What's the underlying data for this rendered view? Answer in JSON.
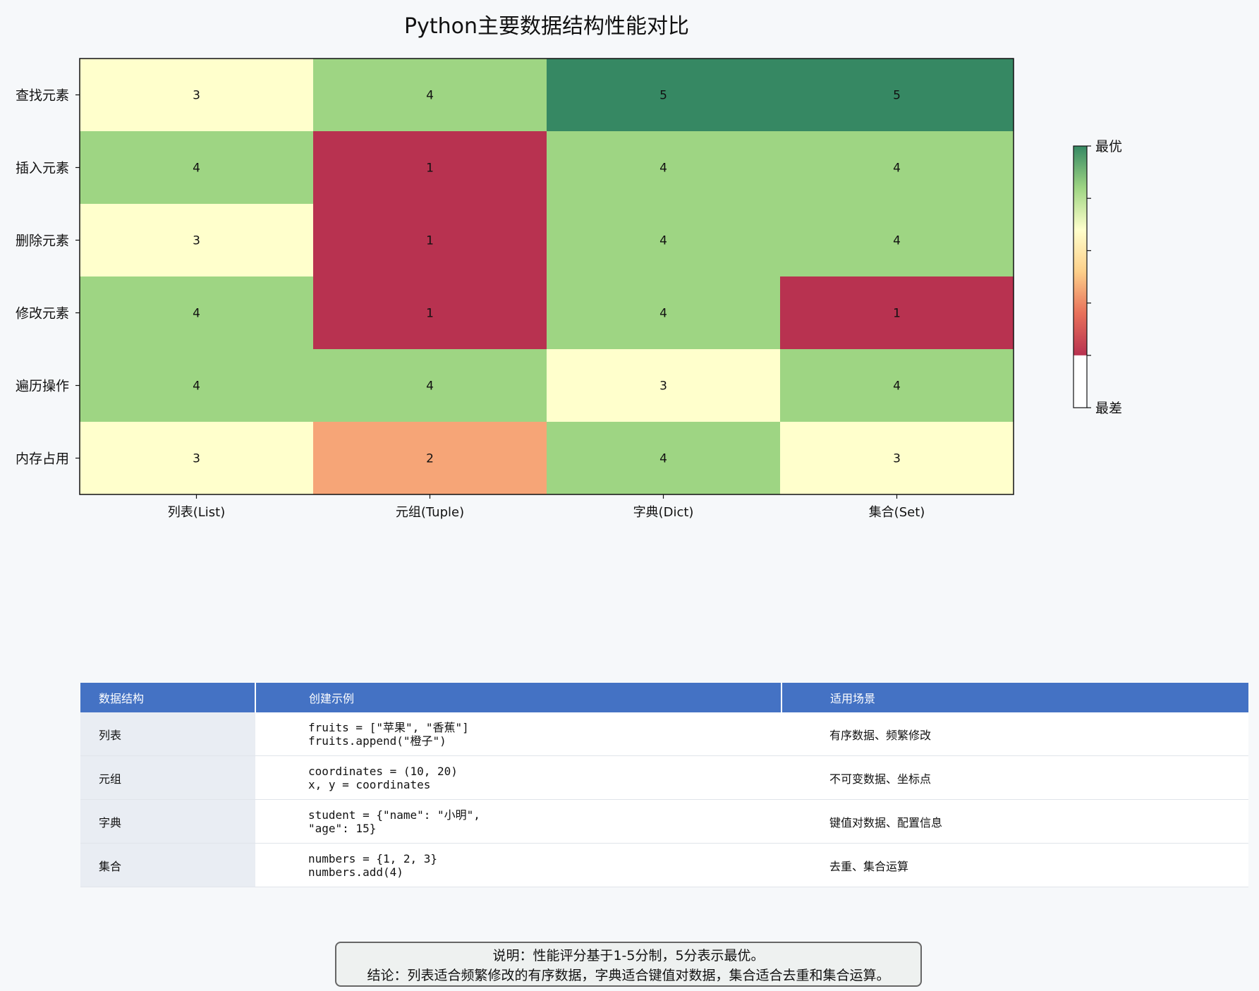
{
  "chart_data": {
    "type": "heatmap",
    "title": "Python主要数据结构性能对比",
    "categories": [
      "列表(List)",
      "元组(Tuple)",
      "字典(Dict)",
      "集合(Set)"
    ],
    "rows": [
      "查找元素",
      "插入元素",
      "删除元素",
      "修改元素",
      "遍历操作",
      "内存占用"
    ],
    "values": [
      [
        3,
        4,
        5,
        5
      ],
      [
        4,
        1,
        4,
        4
      ],
      [
        3,
        1,
        4,
        4
      ],
      [
        4,
        1,
        4,
        1
      ],
      [
        4,
        4,
        3,
        4
      ],
      [
        3,
        2,
        4,
        3
      ]
    ],
    "value_range": [
      1,
      5
    ],
    "colors": {
      "1": "#b83250",
      "2": "#f6a577",
      "3": "#ffffcc",
      "4": "#9ed583",
      "5": "#368863"
    },
    "colorbar": {
      "top_label": "最优",
      "bottom_label": "最差",
      "gradient": [
        "#368863",
        "#9ed583",
        "#ffffcc",
        "#fdd08a",
        "#e8705a",
        "#b83250"
      ]
    },
    "grid": false
  },
  "table": {
    "headers": [
      "数据结构",
      "创建示例",
      "适用场景"
    ],
    "rows": [
      {
        "name": "列表",
        "code": [
          "fruits = [\"苹果\", \"香蕉\"]",
          "fruits.append(\"橙子\")"
        ],
        "use": "有序数据、频繁修改"
      },
      {
        "name": "元组",
        "code": [
          "coordinates = (10, 20)",
          "x, y = coordinates"
        ],
        "use": "不可变数据、坐标点"
      },
      {
        "name": "字典",
        "code": [
          "student = {\"name\": \"小明\",",
          "\"age\": 15}"
        ],
        "use": "键值对数据、配置信息"
      },
      {
        "name": "集合",
        "code": [
          "numbers = {1, 2, 3}",
          "numbers.add(4)"
        ],
        "use": "去重、集合运算"
      }
    ]
  },
  "note": {
    "line1": "说明：性能评分基于1-5分制，5分表示最优。",
    "line2": "结论：列表适合频繁修改的有序数据，字典适合键值对数据，集合适合去重和集合运算。"
  }
}
